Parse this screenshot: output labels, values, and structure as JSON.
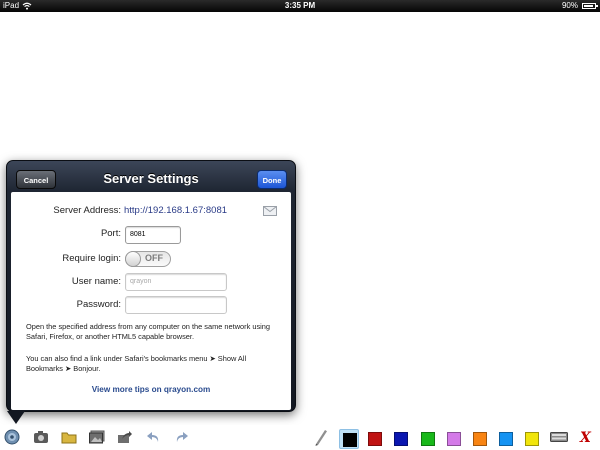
{
  "status_bar": {
    "device": "iPad",
    "time": "3:35 PM",
    "battery": "90%",
    "battery_level": 0.9
  },
  "dialog": {
    "title": "Server Settings",
    "cancel_label": "Cancel",
    "done_label": "Done",
    "server_address_label": "Server Address:",
    "server_address_value": "http://192.168.1.67:8081",
    "port_label": "Port:",
    "port_value": "8081",
    "require_login_label": "Require login:",
    "require_login_state": "OFF",
    "username_label": "User name:",
    "username_placeholder": "qrayon",
    "password_label": "Password:",
    "password_value": "",
    "info_line1": "Open the specified address from any computer on the same network using Safari, Firefox, or another HTML5 capable browser.",
    "info_line2": "You can also find a link under Safari's bookmarks menu ➤ Show All Bookmarks ➤ Bonjour.",
    "tips_link": "View more tips on qrayon.com"
  },
  "toolbar": {
    "tools": [
      "settings-icon",
      "camera-icon",
      "folder-icon",
      "photos-icon",
      "share-icon",
      "undo-icon",
      "redo-icon",
      "pen-icon"
    ],
    "colors": [
      "#000000",
      "#c01313",
      "#0a16b0",
      "#19b81a",
      "#d47ae8",
      "#f88412",
      "#1593f2",
      "#f1e50b"
    ],
    "selected_color": "#000000",
    "close_label": "X"
  }
}
